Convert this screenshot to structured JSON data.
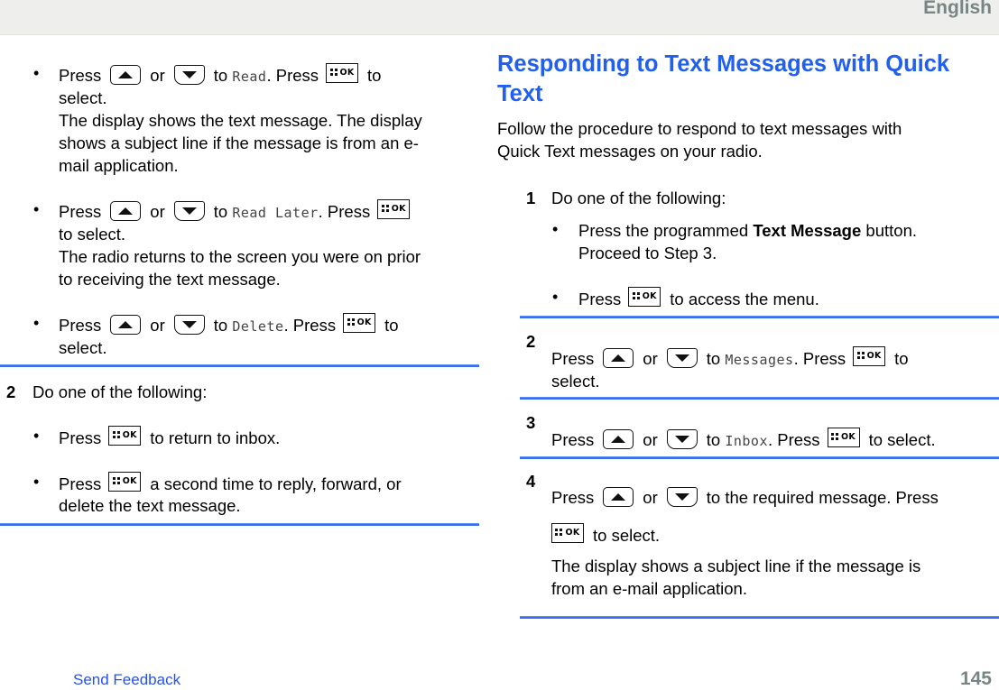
{
  "header": {
    "language": "English"
  },
  "left_column": {
    "step1_bullets": [
      {
        "press": "Press",
        "or": "or",
        "to": "to",
        "menu_item": "Read",
        "press2": ". Press",
        "after": "to",
        "line2": "select.",
        "desc": [
          "The display shows the text message. The display",
          "shows a subject line if the message is from an e-",
          "mail application."
        ]
      },
      {
        "press": "Press",
        "or": "or",
        "to": "to",
        "menu_item": "Read Later",
        "press2": ". Press",
        "after": "",
        "line2": "to select.",
        "desc": [
          "The radio returns to the screen you were on prior",
          "to receiving the text message."
        ]
      },
      {
        "press": "Press",
        "or": "or",
        "to": "to",
        "menu_item": "Delete",
        "press2": ". Press",
        "after": "to",
        "line2": "select.",
        "desc": []
      }
    ],
    "step2": {
      "number": "2",
      "text": "Do one of the following:",
      "bullets": [
        {
          "press": "Press",
          "after": "to return to inbox.",
          "line2": ""
        },
        {
          "press": "Press",
          "after": "a second time to reply, forward, or",
          "line2": "delete the text message."
        }
      ]
    }
  },
  "right_column": {
    "title_lines": [
      "Responding to Text Messages with Quick",
      "Text"
    ],
    "intro_lines": [
      "Follow the procedure to respond to text messages with",
      "Quick Text messages on your radio."
    ],
    "steps": [
      {
        "number": "1",
        "text": "Do one of the following:",
        "bullets": [
          {
            "pre": "Press the programmed ",
            "bold": "Text Message",
            "post": " button.",
            "line2": "Proceed to Step 3."
          },
          {
            "press": "Press",
            "after": "to access the menu."
          }
        ]
      },
      {
        "number": "2",
        "press": "Press",
        "or": "or",
        "to": "to",
        "menu_item": "Messages",
        "press2": ". Press",
        "after": "to",
        "line2": "select."
      },
      {
        "number": "3",
        "press": "Press",
        "or": "or",
        "to": "to",
        "menu_item": "Inbox",
        "press2": ". Press",
        "after": "to select."
      },
      {
        "number": "4",
        "press": "Press",
        "or": "or",
        "after": "to the required message. Press",
        "line2": "to select.",
        "desc": [
          "The display shows a subject line if the message is",
          "from an e-mail application."
        ]
      }
    ]
  },
  "keys": {
    "ok_label": "OK"
  },
  "footer": {
    "feedback_link": "Send Feedback",
    "page_number": "145"
  },
  "colors": {
    "title_blue": "#2160ef",
    "rule_blue": "#3a6ef0",
    "header_gray": "#778584",
    "link_blue": "#2751e6"
  }
}
